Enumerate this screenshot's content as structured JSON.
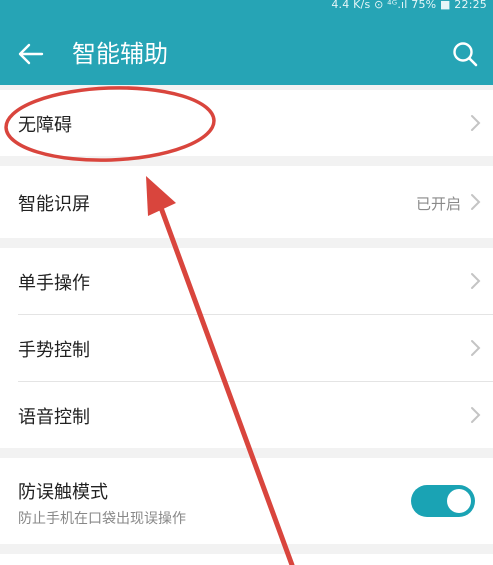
{
  "status_bar": {
    "text": "4.4 K/s  ⊙ ⁴ᴳ.ıl 75% ■ 22:25"
  },
  "app_bar": {
    "title": "智能辅助"
  },
  "items": {
    "accessibility": {
      "label": "无障碍"
    },
    "smart_screen": {
      "label": "智能识屏",
      "value": "已开启"
    },
    "one_hand": {
      "label": "单手操作"
    },
    "gesture": {
      "label": "手势控制"
    },
    "voice": {
      "label": "语音控制"
    },
    "anti_mistouch": {
      "label": "防误触模式",
      "subtext": "防止手机在口袋出现误操作",
      "enabled": true
    }
  },
  "colors": {
    "accent": "#26a4b5",
    "annotation": "#d9453d"
  },
  "icons": {
    "back": "back-arrow-icon",
    "search": "search-icon",
    "chevron": "chevron-right-icon"
  }
}
